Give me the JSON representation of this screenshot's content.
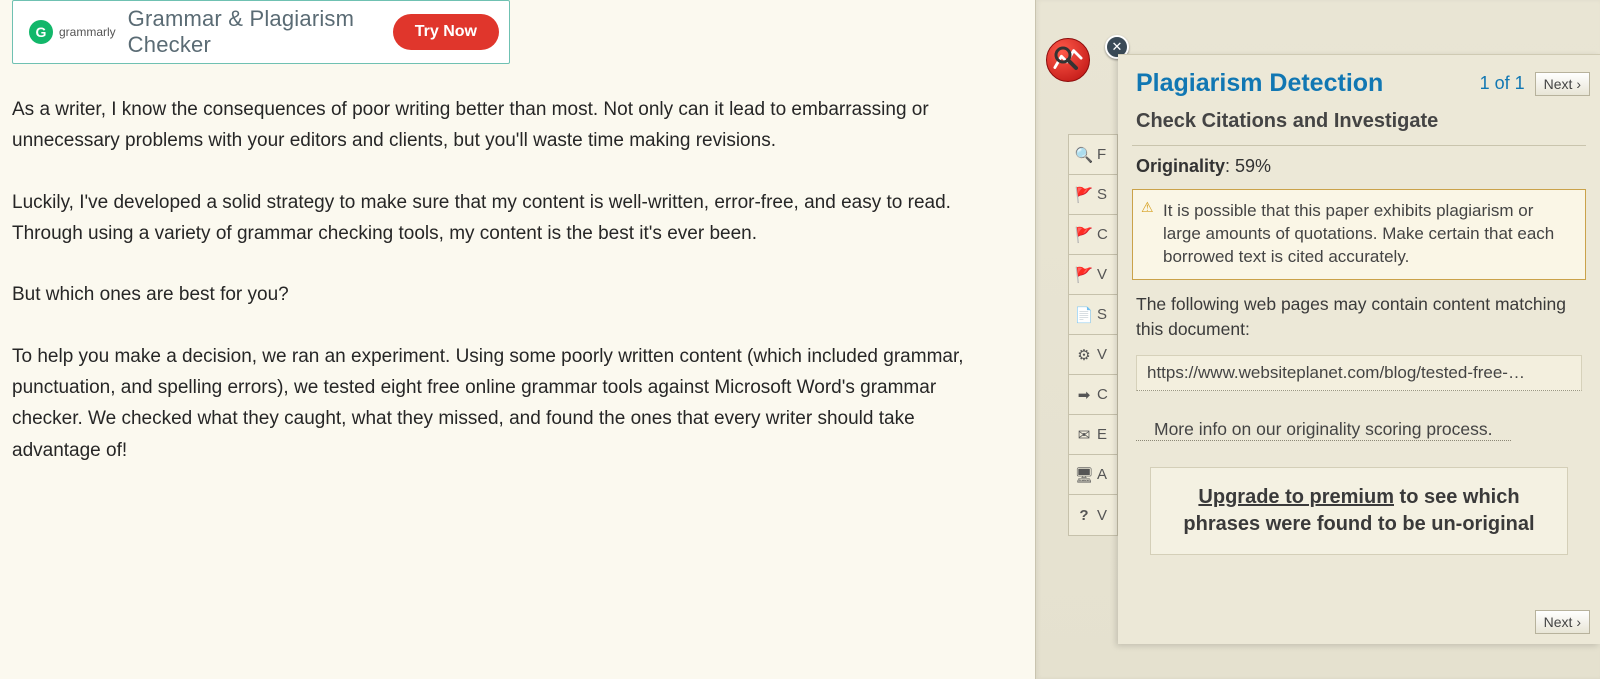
{
  "ad": {
    "logo_text": "grammarly",
    "logo_letter": "G",
    "title": "Grammar & Plagiarism Checker",
    "cta": "Try Now"
  },
  "article": {
    "p1": "As a writer, I know the consequences of poor writing better than most. Not only can it lead to embarrassing or unnecessary problems with your editors and clients, but you'll waste time making revisions.",
    "p2": "Luckily, I've developed a solid strategy to make sure that my content is well-written, error-free, and easy to read. Through using a variety of grammar checking tools, my content is the best it's ever been.",
    "p3": "But which ones are best for you?",
    "p4": "To help you make a decision, we ran an experiment. Using some poorly written content (which included grammar, punctuation, and spelling errors), we tested eight free online grammar tools against Microsoft Word's grammar checker. We checked what they caught, what they missed, and found the ones that every writer should take advantage of!"
  },
  "side_letters": [
    "F",
    "S",
    "C",
    "V",
    "S",
    "V",
    "C",
    "E",
    "A",
    "V"
  ],
  "popup": {
    "title": "Plagiarism Detection",
    "count": "1 of 1",
    "next": "Next ›",
    "subtitle": "Check Citations and Investigate",
    "originality_label": "Originality",
    "originality_value": ": 59%",
    "warning": "It is possible that this paper exhibits plagiarism or large amounts of quotations. Make certain that each borrowed text is cited accurately.",
    "matches_intro": "The following web pages may contain content matching this document:",
    "url": "https://www.websiteplanet.com/blog/tested-free-…",
    "more_info": "More info on our originality scoring process.",
    "upgrade_underline": "Upgrade to premium",
    "upgrade_rest": " to see which phrases were found to be un-original"
  }
}
